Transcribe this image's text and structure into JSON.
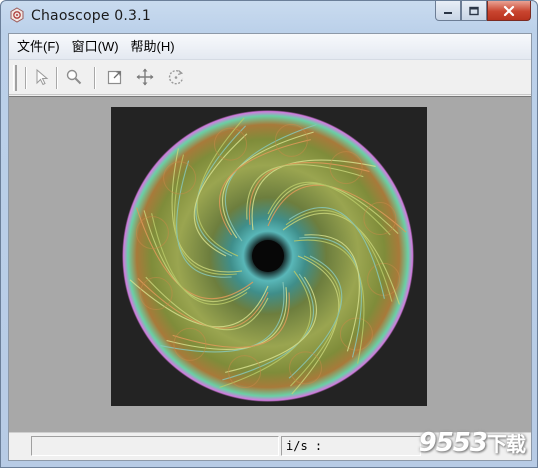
{
  "window": {
    "title": "Chaoscope 0.3.1"
  },
  "menubar": {
    "items": [
      {
        "label": "文件(F)"
      },
      {
        "label": "窗口(W)"
      },
      {
        "label": "帮助(H)"
      }
    ]
  },
  "toolbar": {
    "tools": [
      {
        "icon": "pointer-arrow-icon"
      },
      {
        "icon": "zoom-magnifier-icon"
      },
      {
        "icon": "select-region-icon"
      },
      {
        "icon": "move-pan-icon"
      },
      {
        "icon": "rotate-icon"
      }
    ]
  },
  "statusbar": {
    "rate_label": "i/s :",
    "watermark": "9553",
    "watermark_suffix": "下载"
  },
  "colors": {
    "canvas_background": "#a8a8a8",
    "fractal_background": "#232323"
  }
}
